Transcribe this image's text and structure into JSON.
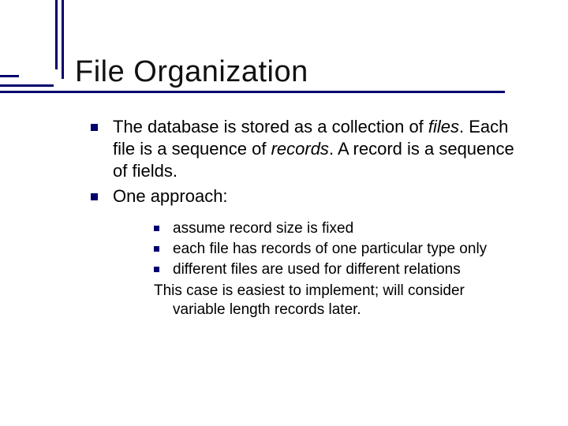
{
  "title": "File Organization",
  "bullets": [
    {
      "pre": "The database is stored as a collection of ",
      "em1": "files",
      "mid": ". Each file is a sequence of ",
      "em2": "records",
      "post": ".  A record is a sequence of fields."
    },
    {
      "text": "One approach:"
    }
  ],
  "subbullets": [
    {
      "pre": "assume record size is ",
      "em": "fixed",
      "post": ""
    },
    {
      "text": "each file has records of one particular type only"
    },
    {
      "text": "different files are used for different relations"
    }
  ],
  "tail": {
    "line1": "This case is easiest to implement; will consider",
    "line2": "variable length records later."
  }
}
